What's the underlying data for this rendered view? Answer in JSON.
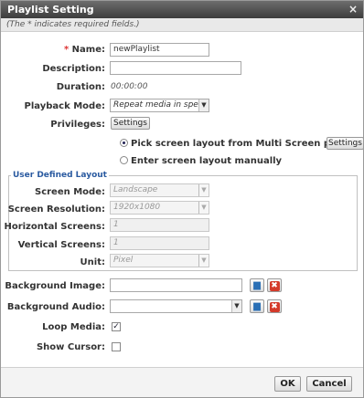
{
  "dialog": {
    "title": "Playlist Setting",
    "close_glyph": "×",
    "required_note": "(The * indicates required fields.)"
  },
  "fields": {
    "name": {
      "required_mark": "*",
      "label": "Name:",
      "value": "newPlaylist"
    },
    "description": {
      "label": "Description:",
      "value": ""
    },
    "duration": {
      "label": "Duration:",
      "value": "00:00:00"
    },
    "playback_mode": {
      "label": "Playback Mode:",
      "value": "Repeat media in speci"
    },
    "privileges": {
      "label": "Privileges:",
      "button": "Settings"
    }
  },
  "layout_choice": {
    "option_multi": {
      "label": "Pick screen layout from Multi Screen player",
      "selected": true,
      "button": "Settings"
    },
    "option_manual": {
      "label": "Enter screen layout manually",
      "selected": false
    }
  },
  "user_defined_layout": {
    "legend": "User Defined Layout",
    "screen_mode": {
      "label": "Screen Mode:",
      "value": "Landscape"
    },
    "screen_resolution": {
      "label": "Screen Resolution:",
      "value": "1920x1080"
    },
    "horizontal_screens": {
      "label": "Horizontal Screens:",
      "value": "1"
    },
    "vertical_screens": {
      "label": "Vertical Screens:",
      "value": "1"
    },
    "unit": {
      "label": "Unit:",
      "value": "Pixel"
    }
  },
  "media": {
    "background_image": {
      "label": "Background Image:",
      "value": ""
    },
    "background_audio": {
      "label": "Background Audio:",
      "value": ""
    },
    "loop_media": {
      "label": "Loop Media:",
      "checked": true
    },
    "show_cursor": {
      "label": "Show Cursor:",
      "checked": false
    }
  },
  "footer": {
    "ok": "OK",
    "cancel": "Cancel"
  },
  "icons": {
    "dropdown": "▼",
    "folder": "▆",
    "delete": "✖",
    "check": "✓"
  },
  "colors": {
    "title_bar": "#4f4f4f",
    "required": "#dd3333",
    "legend": "#2a5aa0",
    "delete": "#d43a2a"
  }
}
